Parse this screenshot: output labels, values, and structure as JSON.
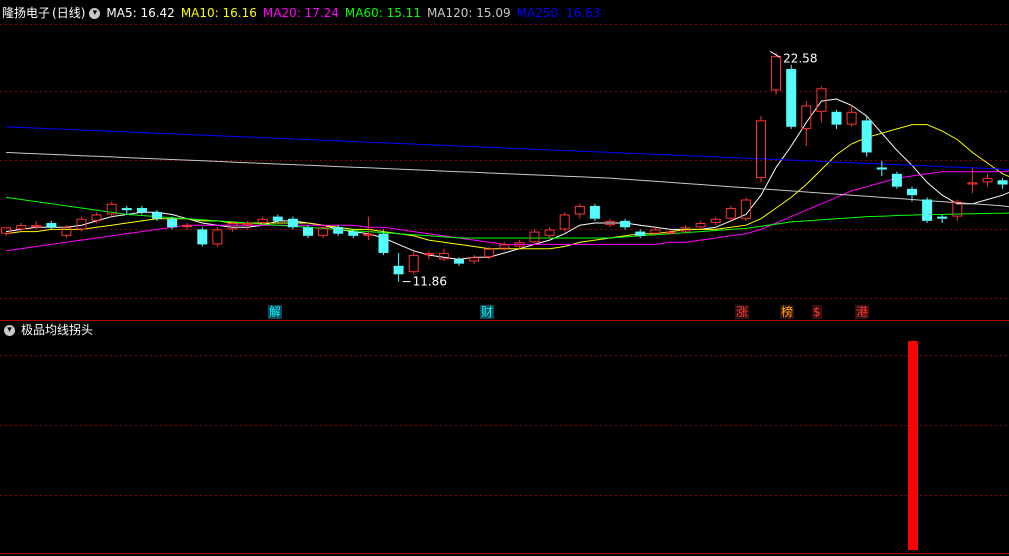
{
  "header": {
    "title": "隆扬电子",
    "period": "(日线)",
    "ma": [
      {
        "label": "MA5: 16.42",
        "color": "#ffffff"
      },
      {
        "label": "MA10: 16.16",
        "color": "#ffff00"
      },
      {
        "label": "MA20: 17.24",
        "color": "#ff00ff"
      },
      {
        "label": "MA60: 15.11",
        "color": "#00ff00"
      },
      {
        "label": "MA120: 15.09",
        "color": "#c8c8c8"
      },
      {
        "label": "MA250: 16.63",
        "color": "#0000ff"
      }
    ]
  },
  "indicator": {
    "title": "极品均线拐头"
  },
  "annotations": {
    "high": "22.58",
    "low": "11.86"
  },
  "events": [
    {
      "label": "解",
      "color": "#00ffff"
    },
    {
      "label": "财",
      "color": "#00ffff"
    },
    {
      "label": "涨",
      "color": "#ff3333"
    },
    {
      "label": "榜",
      "color": "#ffaa00"
    },
    {
      "label": "$",
      "color": "#ff3333"
    },
    {
      "label": "港",
      "color": "#ff3333"
    }
  ],
  "colors": {
    "up": "#ff3232",
    "down": "#54fcfc",
    "grid": "#8b0000",
    "signal": "#ff0000"
  },
  "chart_data": {
    "type": "candlestick",
    "ylim": [
      11.0,
      24.0
    ],
    "candles": [
      [
        14.1,
        14.4,
        14.4,
        14.0
      ],
      [
        14.3,
        14.5,
        14.6,
        14.2
      ],
      [
        14.4,
        14.5,
        14.7,
        14.3
      ],
      [
        14.6,
        14.4,
        14.7,
        14.3
      ],
      [
        14.0,
        14.4,
        14.5,
        13.9
      ],
      [
        14.3,
        14.8,
        14.9,
        14.2
      ],
      [
        14.7,
        15.0,
        15.1,
        14.6
      ],
      [
        15.0,
        15.5,
        15.6,
        14.9
      ],
      [
        15.3,
        15.2,
        15.4,
        15.0
      ],
      [
        15.3,
        15.1,
        15.4,
        15.0
      ],
      [
        15.1,
        14.8,
        15.2,
        14.7
      ],
      [
        14.8,
        14.4,
        14.9,
        14.3
      ],
      [
        14.5,
        14.5,
        14.6,
        14.3
      ],
      [
        14.3,
        13.6,
        14.4,
        13.5
      ],
      [
        13.6,
        14.3,
        14.4,
        13.5
      ],
      [
        14.3,
        14.6,
        14.7,
        14.2
      ],
      [
        14.5,
        14.6,
        14.7,
        14.3
      ],
      [
        14.6,
        14.8,
        14.9,
        14.5
      ],
      [
        14.9,
        14.7,
        15.0,
        14.6
      ],
      [
        14.8,
        14.4,
        14.9,
        14.3
      ],
      [
        14.4,
        14.0,
        14.5,
        13.9
      ],
      [
        14.0,
        14.4,
        14.5,
        13.9
      ],
      [
        14.4,
        14.1,
        14.5,
        14.0
      ],
      [
        14.2,
        14.0,
        14.3,
        13.9
      ],
      [
        14.0,
        14.1,
        14.9,
        13.8
      ],
      [
        14.1,
        13.2,
        14.3,
        13.1
      ],
      [
        12.6,
        12.2,
        13.2,
        11.86
      ],
      [
        12.3,
        13.1,
        13.3,
        12.2
      ],
      [
        13.1,
        13.2,
        13.3,
        12.9
      ],
      [
        12.9,
        13.2,
        13.4,
        12.8
      ],
      [
        12.9,
        12.7,
        13.0,
        12.6
      ],
      [
        12.8,
        13.0,
        13.1,
        12.7
      ],
      [
        13.0,
        13.4,
        13.5,
        12.9
      ],
      [
        13.4,
        13.6,
        13.7,
        13.3
      ],
      [
        13.5,
        13.7,
        13.8,
        13.4
      ],
      [
        13.7,
        14.2,
        14.3,
        13.6
      ],
      [
        14.0,
        14.3,
        14.4,
        13.9
      ],
      [
        14.3,
        15.0,
        15.1,
        14.2
      ],
      [
        15.0,
        15.4,
        15.5,
        14.8
      ],
      [
        15.4,
        14.8,
        15.5,
        14.7
      ],
      [
        14.5,
        14.7,
        14.8,
        14.4
      ],
      [
        14.7,
        14.4,
        14.8,
        14.3
      ],
      [
        14.2,
        14.0,
        14.3,
        13.9
      ],
      [
        14.1,
        14.3,
        14.4,
        14.0
      ],
      [
        14.2,
        14.2,
        14.3,
        14.1
      ],
      [
        14.2,
        14.4,
        14.5,
        14.1
      ],
      [
        14.4,
        14.6,
        14.7,
        14.3
      ],
      [
        14.6,
        14.8,
        14.9,
        14.5
      ],
      [
        14.8,
        15.3,
        15.4,
        14.7
      ],
      [
        14.8,
        15.7,
        15.8,
        14.7
      ],
      [
        16.7,
        19.4,
        19.6,
        16.5
      ],
      [
        20.8,
        22.4,
        22.58,
        20.6
      ],
      [
        21.8,
        19.1,
        22.0,
        19.0
      ],
      [
        19.0,
        20.1,
        20.3,
        18.2
      ],
      [
        19.8,
        20.9,
        21.0,
        19.3
      ],
      [
        19.8,
        19.2,
        19.9,
        19.0
      ],
      [
        19.2,
        19.8,
        20.1,
        19.1
      ],
      [
        19.4,
        17.9,
        19.6,
        17.7
      ],
      [
        17.2,
        17.1,
        17.5,
        16.8
      ],
      [
        16.9,
        16.3,
        17.0,
        16.2
      ],
      [
        16.2,
        15.9,
        16.3,
        15.6
      ],
      [
        15.7,
        14.7,
        15.8,
        14.6
      ],
      [
        14.9,
        14.8,
        15.0,
        14.6
      ],
      [
        14.9,
        15.6,
        15.7,
        14.7
      ],
      [
        16.4,
        16.5,
        17.2,
        16.0
      ],
      [
        16.5,
        16.7,
        16.9,
        16.3
      ],
      [
        16.6,
        16.4,
        16.7,
        16.2
      ],
      [
        16.3,
        16.8,
        17.0,
        16.2
      ],
      [
        16.7,
        17.1,
        17.2,
        16.5
      ],
      [
        17.2,
        17.4,
        17.5,
        17.0
      ],
      [
        17.4,
        16.8,
        17.6,
        16.6
      ]
    ],
    "ma_series": [
      {
        "name": "MA5",
        "values": [
          14.2,
          14.3,
          14.4,
          14.4,
          14.4,
          14.5,
          14.7,
          14.9,
          15.0,
          15.1,
          15.1,
          15.0,
          14.8,
          14.6,
          14.5,
          14.4,
          14.4,
          14.5,
          14.7,
          14.7,
          14.6,
          14.5,
          14.3,
          14.2,
          14.1,
          13.9,
          13.6,
          13.3,
          13.1,
          13.0,
          12.9,
          13.0,
          13.0,
          13.2,
          13.4,
          13.6,
          13.8,
          14.1,
          14.5,
          14.6,
          14.6,
          14.6,
          14.5,
          14.4,
          14.3,
          14.3,
          14.3,
          14.4,
          14.7,
          15.0,
          15.9,
          17.2,
          18.2,
          19.3,
          20.3,
          20.4,
          20.1,
          19.6,
          18.8,
          18.0,
          17.3,
          16.5,
          15.9,
          15.5,
          15.5,
          15.7,
          15.9,
          16.2,
          16.5,
          16.7,
          16.9
        ]
      },
      {
        "name": "MA10",
        "values": [
          14.1,
          14.2,
          14.2,
          14.3,
          14.3,
          14.3,
          14.4,
          14.5,
          14.6,
          14.7,
          14.8,
          14.8,
          14.8,
          14.7,
          14.7,
          14.6,
          14.6,
          14.6,
          14.6,
          14.6,
          14.6,
          14.5,
          14.4,
          14.3,
          14.3,
          14.2,
          14.1,
          14.0,
          13.8,
          13.7,
          13.6,
          13.5,
          13.4,
          13.4,
          13.4,
          13.4,
          13.4,
          13.5,
          13.7,
          13.8,
          13.9,
          14.0,
          14.1,
          14.1,
          14.2,
          14.3,
          14.3,
          14.3,
          14.4,
          14.5,
          14.8,
          15.3,
          15.8,
          16.4,
          17.1,
          17.8,
          18.3,
          18.6,
          18.8,
          19.0,
          19.2,
          19.2,
          18.9,
          18.5,
          17.9,
          17.4,
          16.9,
          16.6,
          16.3,
          16.1,
          16.2
        ]
      },
      {
        "name": "MA20",
        "values": [
          13.3,
          13.4,
          13.5,
          13.6,
          13.7,
          13.8,
          13.9,
          14.0,
          14.1,
          14.2,
          14.3,
          14.4,
          14.5,
          14.5,
          14.5,
          14.5,
          14.5,
          14.5,
          14.5,
          14.5,
          14.5,
          14.5,
          14.5,
          14.5,
          14.4,
          14.4,
          14.3,
          14.2,
          14.1,
          14.0,
          13.9,
          13.8,
          13.7,
          13.6,
          13.6,
          13.6,
          13.6,
          13.6,
          13.6,
          13.6,
          13.6,
          13.6,
          13.6,
          13.6,
          13.7,
          13.7,
          13.8,
          13.9,
          14.0,
          14.1,
          14.3,
          14.6,
          14.9,
          15.2,
          15.5,
          15.8,
          16.1,
          16.3,
          16.5,
          16.7,
          16.8,
          16.9,
          17.0,
          17.0,
          17.0,
          17.0,
          17.0,
          17.1,
          17.1,
          17.2,
          17.24
        ]
      },
      {
        "name": "MA60",
        "values": [
          15.8,
          15.7,
          15.6,
          15.5,
          15.4,
          15.3,
          15.2,
          15.1,
          15.0,
          14.95,
          14.9,
          14.85,
          14.8,
          14.75,
          14.7,
          14.65,
          14.6,
          14.55,
          14.5,
          14.45,
          14.4,
          14.35,
          14.3,
          14.25,
          14.2,
          14.15,
          14.1,
          14.05,
          14.0,
          13.95,
          13.9,
          13.9,
          13.9,
          13.9,
          13.9,
          13.9,
          13.9,
          13.9,
          13.9,
          13.9,
          13.9,
          13.95,
          14.0,
          14.05,
          14.1,
          14.15,
          14.2,
          14.25,
          14.3,
          14.35,
          14.45,
          14.55,
          14.65,
          14.7,
          14.75,
          14.8,
          14.85,
          14.9,
          14.92,
          14.95,
          14.97,
          15.0,
          15.0,
          15.02,
          15.03,
          15.05,
          15.06,
          15.08,
          15.09,
          15.1,
          15.11
        ]
      },
      {
        "name": "MA120",
        "values": [
          17.9,
          17.87,
          17.84,
          17.81,
          17.78,
          17.75,
          17.72,
          17.69,
          17.66,
          17.63,
          17.6,
          17.57,
          17.54,
          17.51,
          17.48,
          17.45,
          17.42,
          17.39,
          17.36,
          17.33,
          17.3,
          17.27,
          17.24,
          17.21,
          17.18,
          17.15,
          17.12,
          17.09,
          17.06,
          17.03,
          17.0,
          16.97,
          16.94,
          16.91,
          16.88,
          16.85,
          16.82,
          16.79,
          16.76,
          16.73,
          16.7,
          16.65,
          16.6,
          16.55,
          16.5,
          16.45,
          16.4,
          16.35,
          16.3,
          16.25,
          16.2,
          16.15,
          16.1,
          16.05,
          16.0,
          15.95,
          15.9,
          15.85,
          15.8,
          15.75,
          15.7,
          15.65,
          15.6,
          15.55,
          15.5,
          15.45,
          15.4,
          15.3,
          15.2,
          15.15,
          15.09
        ]
      },
      {
        "name": "MA250",
        "values": [
          19.1,
          19.07,
          19.04,
          19.01,
          18.98,
          18.95,
          18.92,
          18.89,
          18.86,
          18.83,
          18.8,
          18.77,
          18.74,
          18.71,
          18.68,
          18.65,
          18.62,
          18.59,
          18.56,
          18.53,
          18.5,
          18.47,
          18.44,
          18.41,
          18.38,
          18.35,
          18.32,
          18.29,
          18.26,
          18.23,
          18.2,
          18.17,
          18.14,
          18.11,
          18.08,
          18.05,
          18.02,
          17.99,
          17.96,
          17.93,
          17.9,
          17.87,
          17.84,
          17.81,
          17.78,
          17.75,
          17.72,
          17.69,
          17.66,
          17.63,
          17.6,
          17.57,
          17.54,
          17.51,
          17.48,
          17.45,
          17.42,
          17.39,
          17.36,
          17.33,
          17.3,
          17.27,
          17.24,
          17.21,
          17.18,
          17.15,
          17.12,
          17.05,
          16.95,
          16.8,
          16.63
        ]
      }
    ],
    "indicator_bars": [
      {
        "index": 60,
        "value": 1
      }
    ]
  }
}
